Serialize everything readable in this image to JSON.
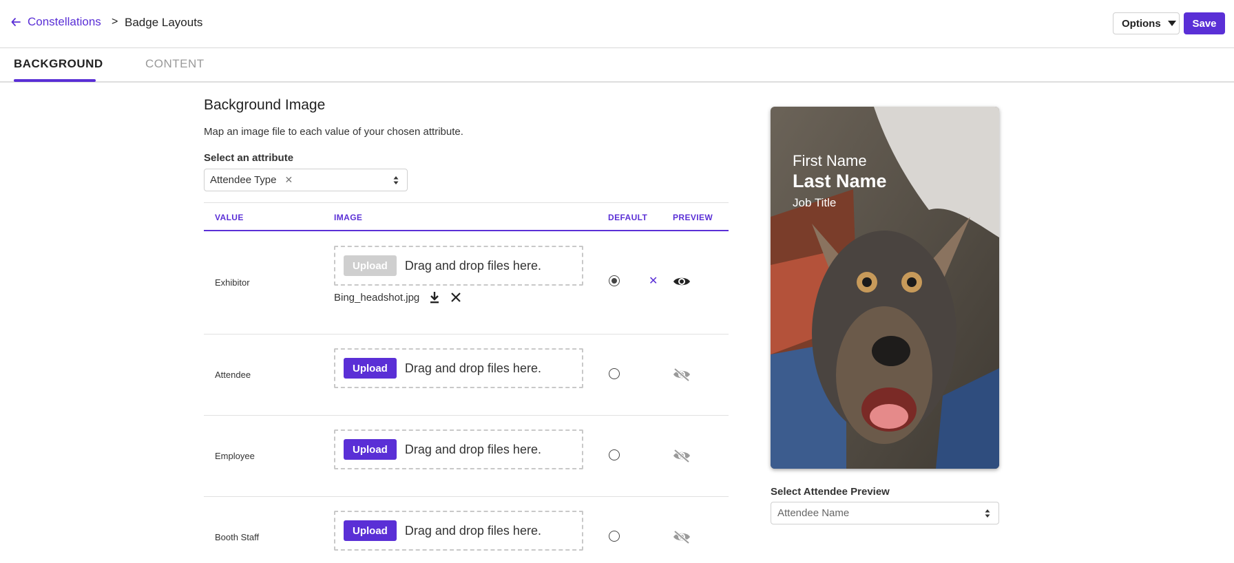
{
  "header": {
    "back_label": "Constellations",
    "separator": ">",
    "current_page": "Badge Layouts",
    "options_label": "Options",
    "save_label": "Save"
  },
  "tabs": [
    {
      "label": "BACKGROUND",
      "active": true
    },
    {
      "label": "CONTENT",
      "active": false
    }
  ],
  "section": {
    "title": "Background Image",
    "description": "Map an image file to each value of your chosen attribute.",
    "attribute_label": "Select an attribute",
    "attribute_value": "Attendee Type"
  },
  "table": {
    "headers": {
      "value": "VALUE",
      "image": "IMAGE",
      "default": "DEFAULT",
      "preview": "PREVIEW"
    },
    "upload_label": "Upload",
    "drop_text": "Drag and drop files here.",
    "rows": [
      {
        "value": "Exhibitor",
        "file": "Bing_headshot.jpg",
        "default": true,
        "preview_visible": true,
        "upload_disabled": true
      },
      {
        "value": "Attendee",
        "file": "",
        "default": false,
        "preview_visible": false,
        "upload_disabled": false
      },
      {
        "value": "Employee",
        "file": "",
        "default": false,
        "preview_visible": false,
        "upload_disabled": false
      },
      {
        "value": "Booth Staff",
        "file": "",
        "default": false,
        "preview_visible": false,
        "upload_disabled": false
      }
    ]
  },
  "badge": {
    "first_name": "First Name",
    "last_name": "Last Name",
    "job_title": "Job Title"
  },
  "preview_select": {
    "label": "Select Attendee Preview",
    "placeholder": "Attendee Name"
  },
  "colors": {
    "accent": "#5a2fd6"
  }
}
